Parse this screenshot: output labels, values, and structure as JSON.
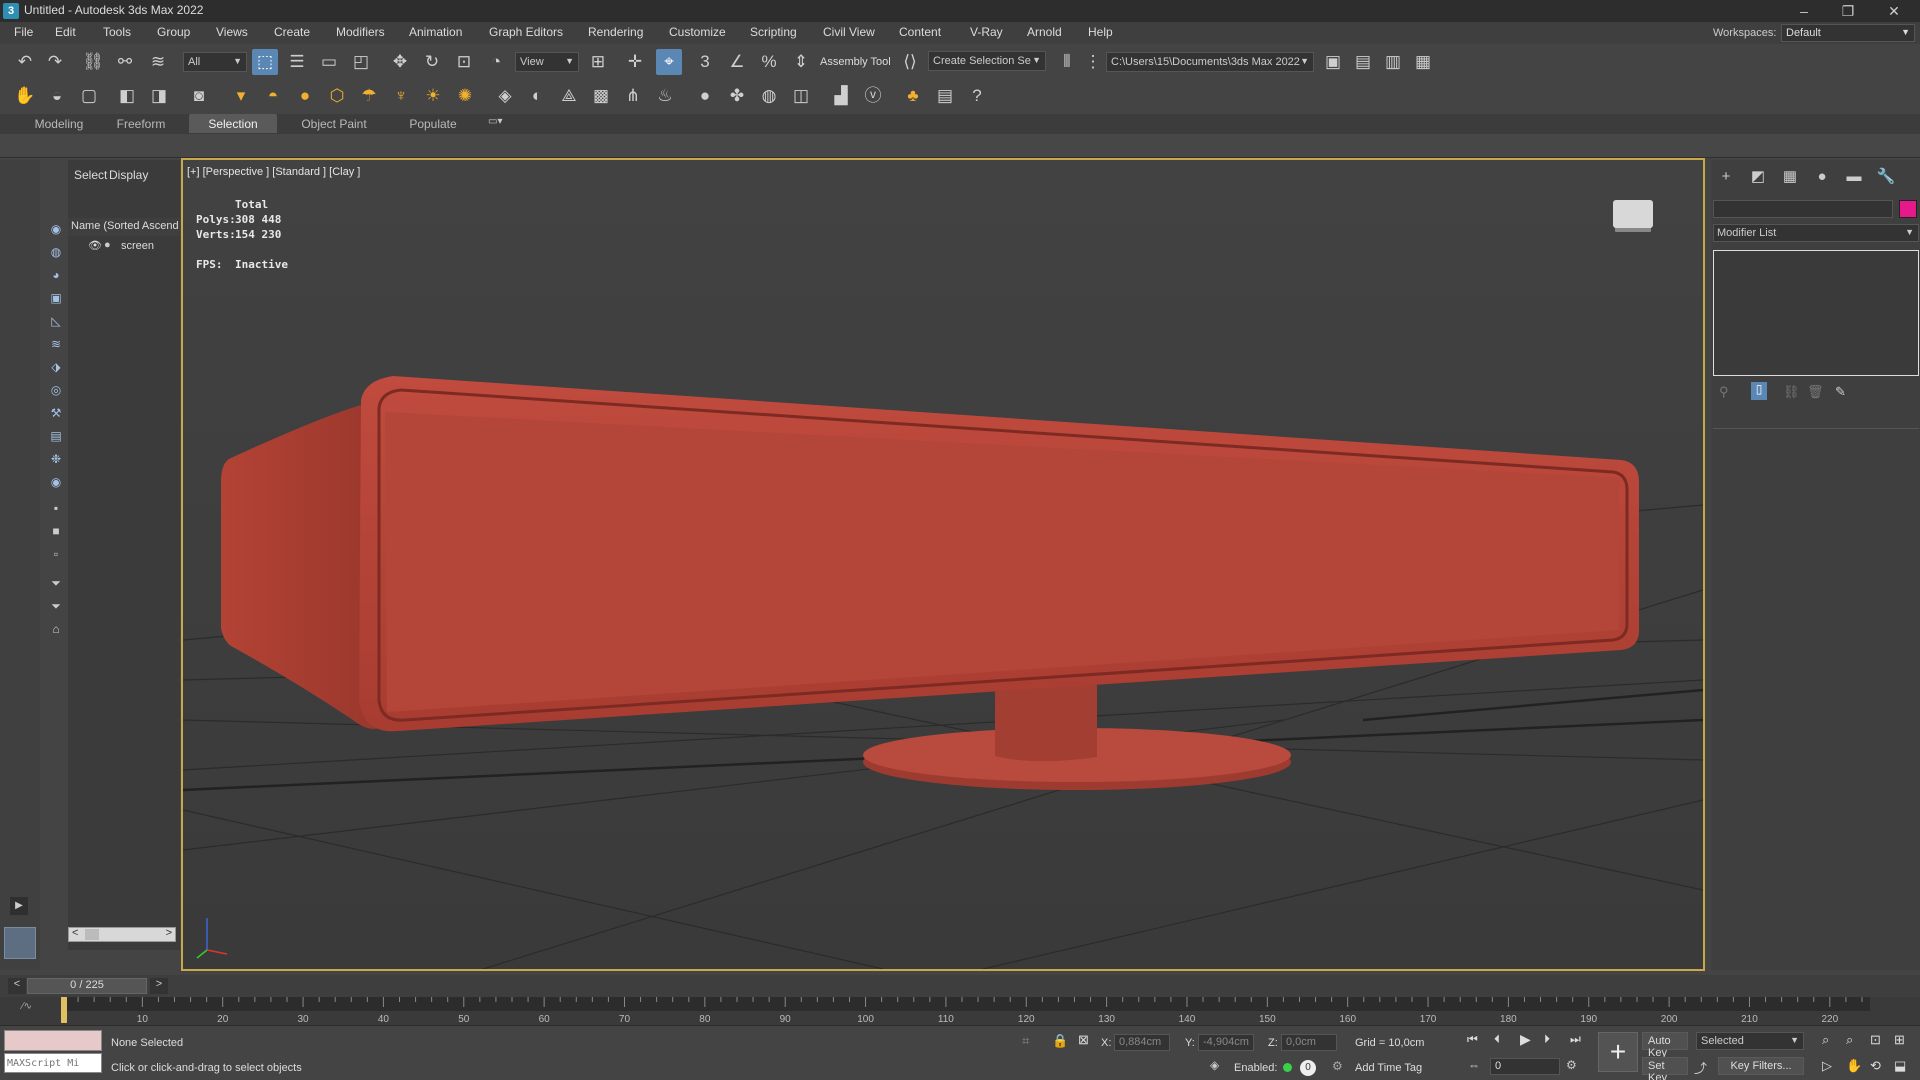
{
  "window": {
    "title": "Untitled - Autodesk 3ds Max 2022",
    "min": "–",
    "restore": "❐",
    "close": "✕"
  },
  "menu": [
    "File",
    "Edit",
    "Tools",
    "Group",
    "Views",
    "Create",
    "Modifiers",
    "Animation",
    "Graph Editors",
    "Rendering",
    "Customize",
    "Scripting",
    "Civil View",
    "Content",
    "V-Ray",
    "Arnold",
    "Help"
  ],
  "workspace": {
    "label": "Workspaces:",
    "value": "Default"
  },
  "toolbar1": {
    "filter_value": "All",
    "refcoord_value": "View",
    "assembly_tool": "Assembly Tool",
    "named_selection": "Create Selection Se",
    "project_path": "C:\\Users\\15\\Documents\\3ds Max 2022"
  },
  "ribbon": {
    "tabs": [
      "Modeling",
      "Freeform",
      "Selection",
      "Object Paint",
      "Populate"
    ],
    "active_tab": "Selection"
  },
  "scene_explorer": {
    "tabs": [
      "Select",
      "Display"
    ],
    "column_header": "Name (Sorted Ascend",
    "objects": [
      {
        "name": "screen"
      }
    ]
  },
  "viewport": {
    "label": "[+] [Perspective ] [Standard ] [Clay ]",
    "stats": {
      "total_label": "Total",
      "polys_label": "Polys:",
      "polys": "308 448",
      "verts_label": "Verts:",
      "verts": "154 230",
      "fps_label": "FPS:",
      "fps": "Inactive"
    },
    "object_color": "#b5463a",
    "border_color": "#c9a84b"
  },
  "command_panel": {
    "modifier_list": "Modifier List",
    "object_color": "#e6198a"
  },
  "timeline": {
    "frame_display": "0 / 225",
    "current_frame": 0,
    "total_frames": 225,
    "ticks": [
      "10",
      "20",
      "30",
      "40",
      "50",
      "60",
      "70",
      "80",
      "90",
      "100",
      "110",
      "120",
      "130",
      "140",
      "150",
      "160",
      "170",
      "180",
      "190",
      "200",
      "210",
      "220"
    ]
  },
  "status": {
    "maxscript_placeholder": "MAXScript Mi",
    "selection": "None Selected",
    "prompt": "Click or click-and-drag to select objects",
    "x_label": "X:",
    "x_value": "0,884cm",
    "y_label": "Y:",
    "y_value": "-4,904cm",
    "z_label": "Z:",
    "z_value": "0,0cm",
    "grid": "Grid = 10,0cm",
    "enabled_label": "Enabled:",
    "add_time_tag": "Add Time Tag",
    "auto_key": "Auto Key",
    "selected_dropdown": "Selected",
    "set_key": "Set Key",
    "key_filters": "Key Filters...",
    "frame_field": "0"
  }
}
